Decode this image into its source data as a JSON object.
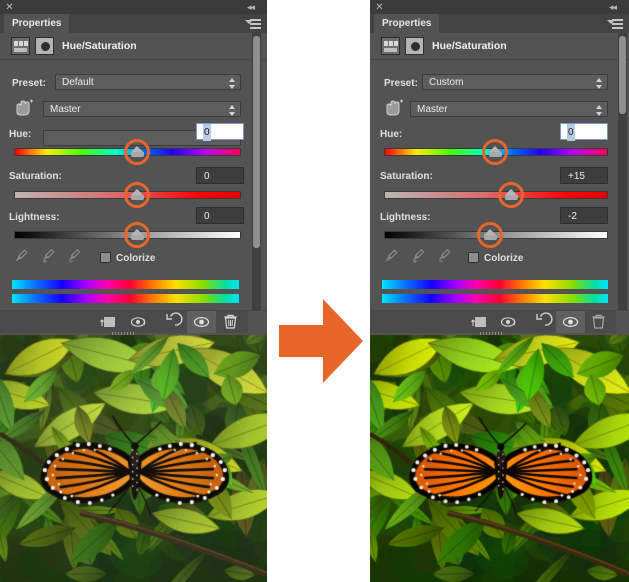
{
  "app": {
    "panel_title": "Properties",
    "adjustment_name": "Hue/Saturation",
    "close_icon": "close-icon",
    "collapse_icon": "collapse-to-icons-icon",
    "menu_icon": "panel-menu-icon"
  },
  "left_panel": {
    "tab_label": "Properties",
    "title": "Hue/Saturation",
    "preset_label": "Preset:",
    "preset_value": "Default",
    "channel_value": "Master",
    "hue_label": "Hue:",
    "hue_value": "0",
    "saturation_label": "Saturation:",
    "saturation_value": "0",
    "lightness_label": "Lightness:",
    "lightness_value": "0",
    "colorize_label": "Colorize",
    "hue_knob_pct": 50,
    "saturation_knob_pct": 50,
    "lightness_knob_pct": 50,
    "hue_field_active": true,
    "toolbar": {
      "clip_label": "clip-to-layer-icon",
      "preview_prev_label": "toggle-previous-state-icon",
      "reset_label": "reset-icon",
      "visibility_label": "toggle-layer-visibility-icon",
      "delete_label": "delete-adjustment-icon"
    }
  },
  "right_panel": {
    "tab_label": "Properties",
    "title": "Hue/Saturation",
    "preset_label": "Preset:",
    "preset_value": "Custom",
    "channel_value": "Master",
    "hue_label": "Hue:",
    "hue_value": "0",
    "saturation_label": "Saturation:",
    "saturation_value": "+15",
    "lightness_label": "Lightness:",
    "lightness_value": "-2",
    "colorize_label": "Colorize",
    "hue_knob_pct": 50,
    "saturation_knob_pct": 57,
    "lightness_knob_pct": 44,
    "hue_field_active": true,
    "toolbar": {
      "clip_label": "clip-to-layer-icon",
      "preview_prev_label": "toggle-previous-state-icon",
      "reset_label": "reset-icon",
      "visibility_label": "toggle-layer-visibility-icon",
      "delete_label": "delete-adjustment-icon"
    }
  },
  "arrow": {
    "name": "right-arrow-icon",
    "color": "#e8662a"
  },
  "images": {
    "before": {
      "alt": "monarch-butterfly-before",
      "saturation": 1.0,
      "lightness": 0
    },
    "after": {
      "alt": "monarch-butterfly-after",
      "saturation": 1.35,
      "lightness": -0.03
    }
  },
  "colors": {
    "panel_bg": "#535353",
    "panel_header": "#3b3b3b",
    "tab_bg": "#434343",
    "accent_orange": "#e8662a",
    "field_bg": "#3d3d3d",
    "text": "#e8e8e8"
  }
}
